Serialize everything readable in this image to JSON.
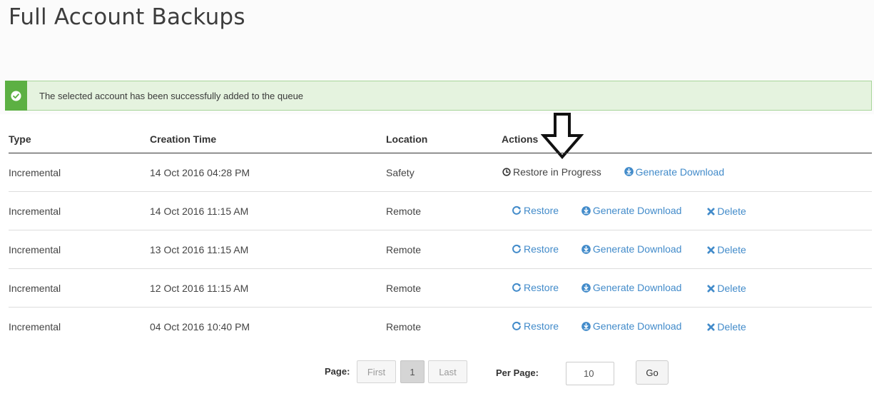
{
  "page": {
    "title": "Full Account Backups"
  },
  "alert": {
    "message": "The selected account has been successfully added to the queue",
    "icon": "check-circle-icon",
    "color": "#5cb043"
  },
  "table": {
    "headers": {
      "type": "Type",
      "creation_time": "Creation Time",
      "location": "Location",
      "actions": "Actions"
    },
    "rows": [
      {
        "type": "Incremental",
        "creation_time": "14 Oct 2016 04:28 PM",
        "location": "Safety"
      },
      {
        "type": "Incremental",
        "creation_time": "14 Oct 2016 11:15 AM",
        "location": "Remote"
      },
      {
        "type": "Incremental",
        "creation_time": "13 Oct 2016 11:15 AM",
        "location": "Remote"
      },
      {
        "type": "Incremental",
        "creation_time": "12 Oct 2016 11:15 AM",
        "location": "Remote"
      },
      {
        "type": "Incremental",
        "creation_time": "04 Oct 2016 10:40 PM",
        "location": "Remote"
      }
    ],
    "actions": {
      "restore_in_progress": "Restore in Progress",
      "restore": "Restore",
      "generate_download": "Generate Download",
      "delete": "Delete"
    },
    "link_color": "#428bca"
  },
  "pagination": {
    "page_label": "Page:",
    "first": "First",
    "current_page": "1",
    "last": "Last",
    "per_page_label": "Per Page:",
    "per_page_value": "10",
    "go": "Go"
  }
}
